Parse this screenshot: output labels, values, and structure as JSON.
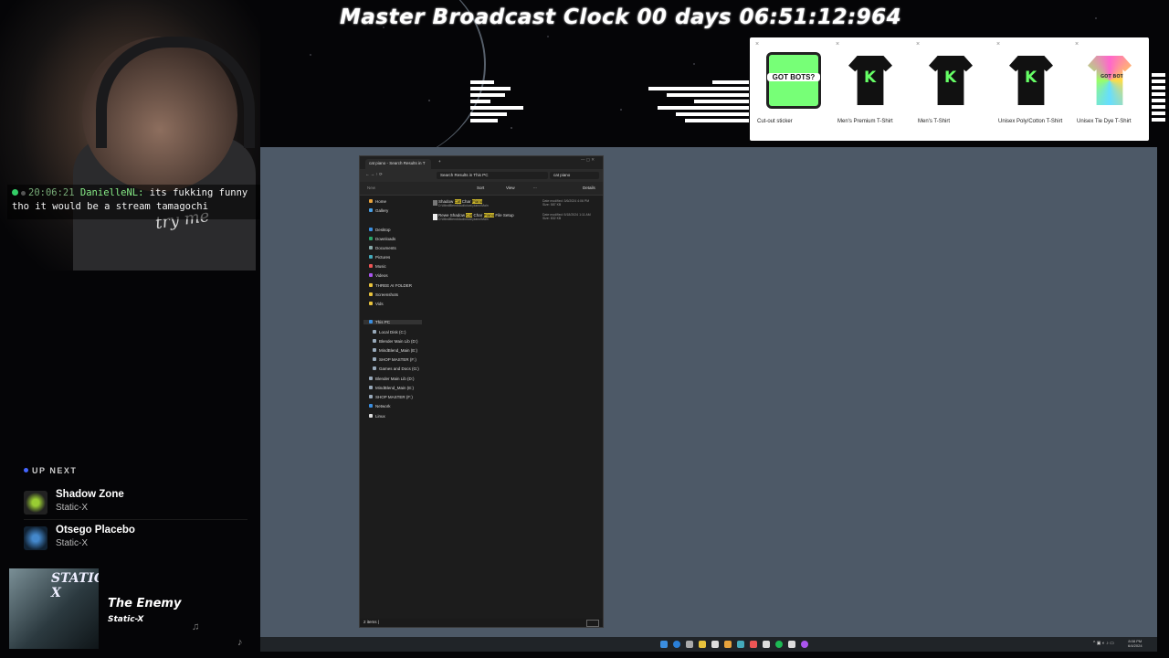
{
  "clock": {
    "text": "Master Broadcast Clock 00 days 06:51:12:964"
  },
  "webcam": {
    "shirt_text": "try me"
  },
  "chat": {
    "time": "20:06:21",
    "user": "DanielleNL:",
    "message_line1": "its fukking funny",
    "message_line2": "tho it would be a stream tamagochi"
  },
  "up_next": {
    "label": "UP NEXT",
    "songs": [
      {
        "title": "Shadow Zone",
        "artist": "Static-X"
      },
      {
        "title": "Otsego Placebo",
        "artist": "Static-X"
      }
    ]
  },
  "now_playing": {
    "title": "The Enemy",
    "artist": "Static-X",
    "album_text": "STATIC-X"
  },
  "shop": {
    "items": [
      {
        "label": "Cut-out sticker",
        "art_text": "GOT BOTS?"
      },
      {
        "label": "Men's Premium T-Shirt",
        "art_text": "K"
      },
      {
        "label": "Men's T-Shirt",
        "art_text": "K"
      },
      {
        "label": "Unisex Poly/Cotton T-Shirt",
        "art_text": "K"
      },
      {
        "label": "Unisex Tie Dye T-Shirt",
        "art_text": "GOT BOTS?"
      }
    ]
  },
  "explorer": {
    "tab_title": "cat piano - Search Results in T",
    "address": "Search Results in This PC",
    "search_value": "cat piano",
    "cmd": {
      "new": "New",
      "sort": "Sort",
      "view": "View",
      "more": "...",
      "details": "Details"
    },
    "sidebar": [
      "Home",
      "Gallery",
      "Desktop",
      "Downloads",
      "Documents",
      "Pictures",
      "Music",
      "Videos",
      "THREE AI FOLDER",
      "Screenshots",
      "Vids",
      "This PC",
      "Local Disk (C:)",
      "Blender Main Lib (D:)",
      "MindBlend_Main (E:)",
      "SHOP MASTER (F:)",
      "Games and Docs (G:)",
      "Blender Main Lib (D:)",
      "MindBlend_Main (E:)",
      "SHOP MASTER (F:)",
      "Network",
      "Linux"
    ],
    "results": [
      {
        "pre": "Shadow ",
        "hl1": "Cat",
        "mid": " Char ",
        "hl2": "Piano",
        "post": "",
        "path": "D:\\MindBlend\\Audio\\cat piano\\Main",
        "meta1": "Date modified: 3/6/2024 4:06 PM",
        "meta2": "Size: 587 KB"
      },
      {
        "pre": "Rewe Shadow ",
        "hl1": "Cat",
        "mid": " Char ",
        "hl2": "Piano",
        "post": " File Setup ",
        "path": "D:\\MindBlend\\Audio\\cat piano\\Main",
        "meta1": "Date modified: 5/18/2024 1:11 AM",
        "meta2": "Size: 832 KB"
      }
    ],
    "status": "2 items  |"
  },
  "taskbar": {
    "time": "8:08 PM",
    "date": "6/4/2024"
  }
}
